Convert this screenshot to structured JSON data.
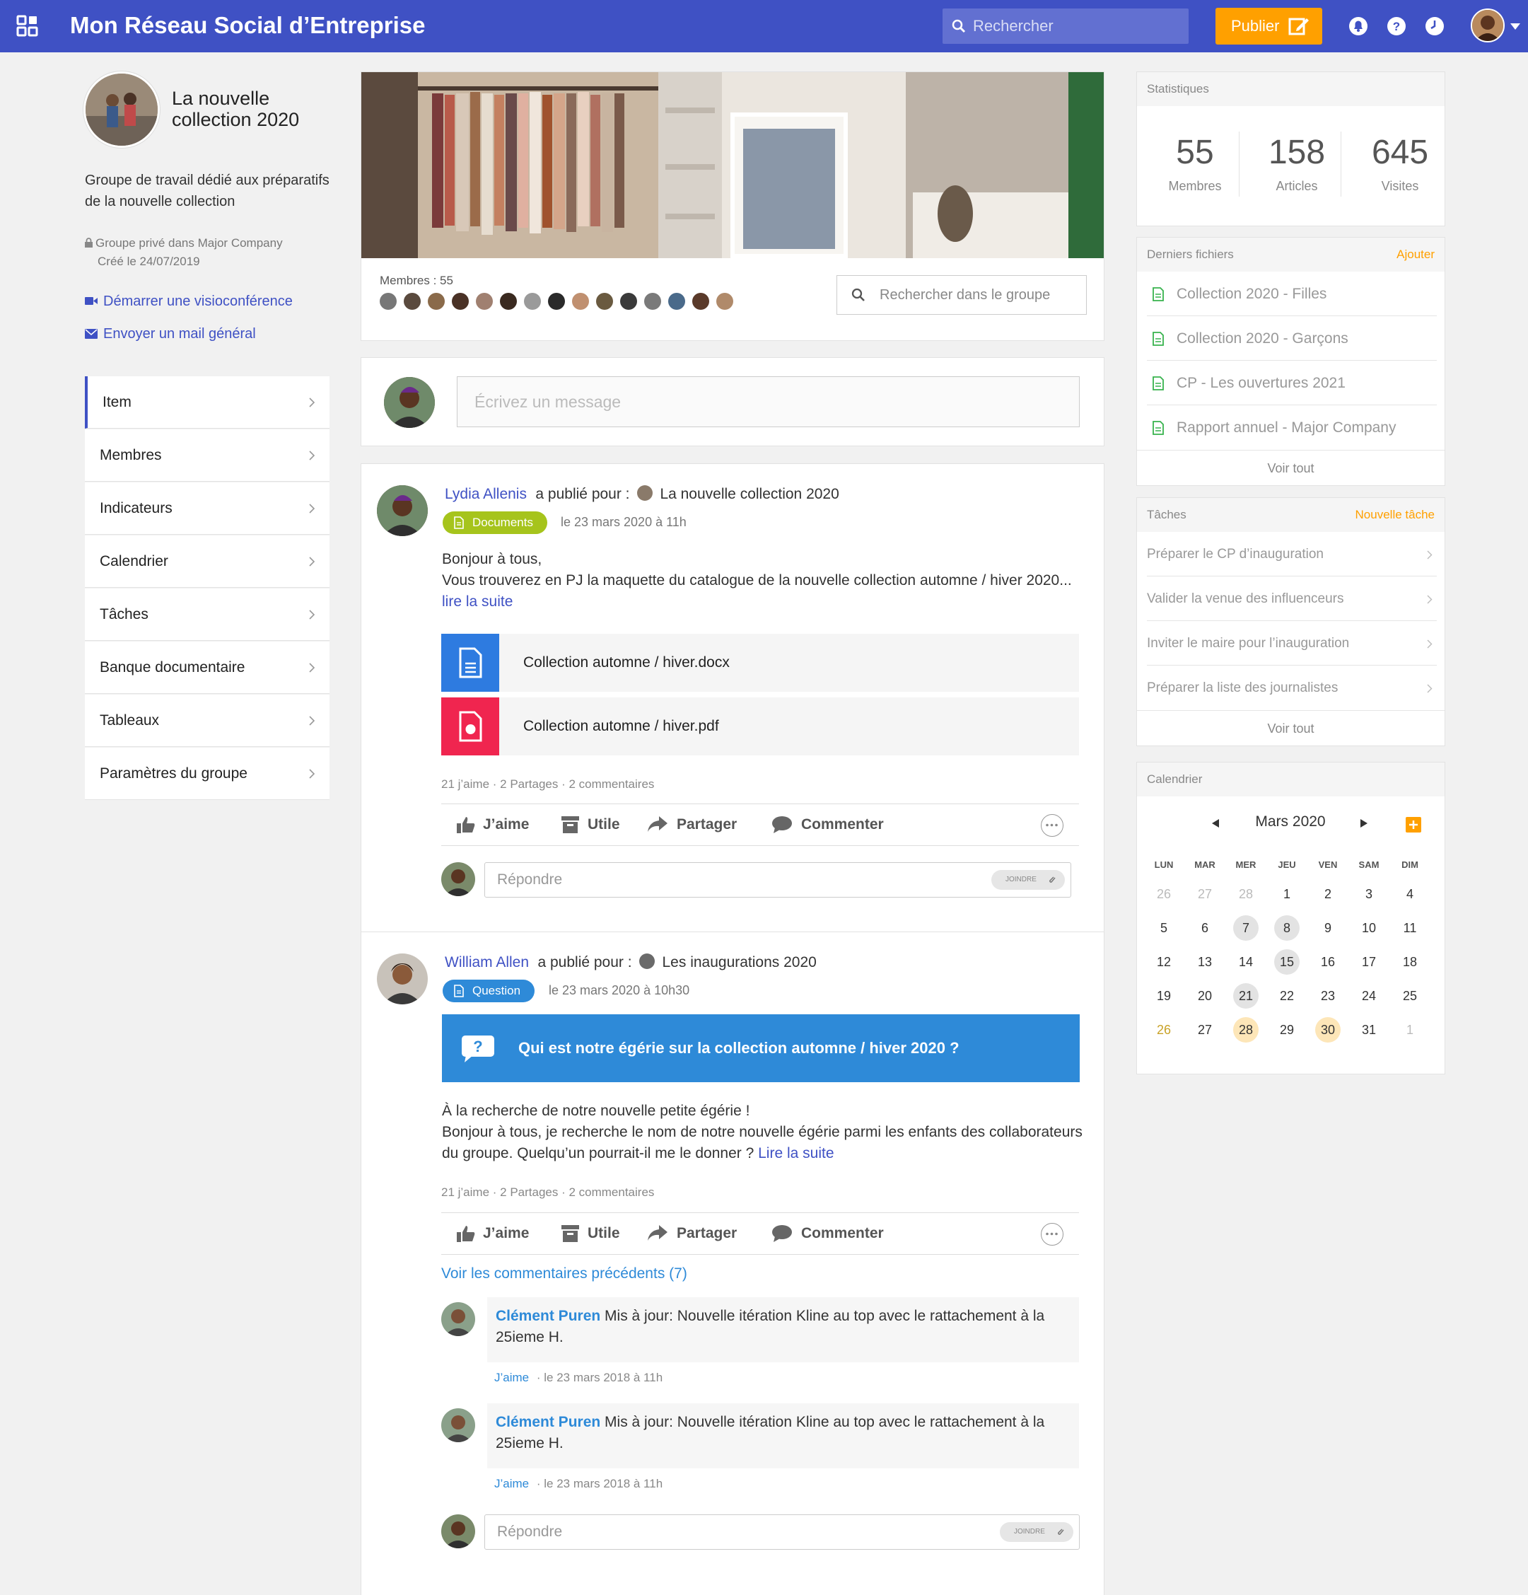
{
  "app": {
    "title": "Mon Réseau Social d’Entreprise",
    "search_placeholder": "Rechercher",
    "publish_label": "Publier"
  },
  "colors": {
    "primary": "#3f51c4",
    "accent": "#ffa000",
    "link": "#2e8ad8"
  },
  "group": {
    "title": "La nouvelle collection 2020",
    "description": "Groupe de travail dédié aux préparatifs de la nouvelle collection",
    "privacy": "Groupe privé dans Major Company",
    "created": "Créé le 24/07/2019",
    "video_link": "Démarrer une visioconférence",
    "mail_link": "Envoyer un mail général"
  },
  "nav": [
    "Item",
    "Membres",
    "Indicateurs",
    "Calendrier",
    "Tâches",
    "Banque documentaire",
    "Tableaux",
    "Paramètres du groupe"
  ],
  "cover": {
    "members_label": "Membres : 55",
    "search_placeholder": "Rechercher dans le groupe"
  },
  "composer": {
    "placeholder": "Écrivez un message"
  },
  "posts": [
    {
      "author": "Lydia Allenis",
      "published_for": "a publié pour :",
      "target": "La nouvelle collection 2020",
      "badge": "Documents",
      "date": "le 23 mars 2020 à 11h",
      "line1": "Bonjour à tous,",
      "line2": "Vous trouverez en PJ la maquette du catalogue de la nouvelle collection automne / hiver 2020...",
      "read_more": "lire la suite",
      "files": [
        "Collection automne / hiver.docx",
        "Collection automne / hiver.pdf"
      ],
      "stats": "21 j’aime · 2 Partages · 2 commentaires",
      "reply_placeholder": "Répondre",
      "joindre": "JOINDRE"
    },
    {
      "author": "William Allen",
      "published_for": "a publié pour :",
      "target": "Les inaugurations 2020",
      "badge": "Question",
      "date": "le 23 mars 2020 à 10h30",
      "question": "Qui est notre égérie sur la collection automne / hiver 2020 ?",
      "line1": "À la recherche de notre nouvelle petite égérie !",
      "line2": "Bonjour à tous, je recherche le nom de notre nouvelle égérie parmi les enfants des collaborateurs",
      "line3": "du groupe. Quelqu’un pourrait-il me le donner ?",
      "read_more": "Lire la suite",
      "stats": "21 j’aime · 2 Partages · 2 commentaires",
      "see_previous": "Voir les commentaires précédents (7)",
      "comments": [
        {
          "author": "Clément Puren",
          "text": "Mis à jour: Nouvelle itération Kline au top avec le rattachement à la",
          "text2": "25ieme H.",
          "like": "J’aime",
          "date": "· le 23 mars 2018 à 11h"
        },
        {
          "author": "Clément Puren",
          "text": "Mis à jour: Nouvelle itération Kline au top avec le rattachement à la",
          "text2": "25ieme H.",
          "like": "J’aime",
          "date": "· le 23 mars 2018 à 11h"
        }
      ],
      "reply_placeholder": "Répondre",
      "joindre": "JOINDRE"
    }
  ],
  "actions": {
    "like": "J’aime",
    "useful": "Utile",
    "share": "Partager",
    "comment": "Commenter"
  },
  "stats_card": {
    "title": "Statistiques",
    "items": [
      {
        "value": "55",
        "label": "Membres"
      },
      {
        "value": "158",
        "label": "Articles"
      },
      {
        "value": "645",
        "label": "Visites"
      }
    ]
  },
  "files_card": {
    "title": "Derniers fichiers",
    "action": "Ajouter",
    "items": [
      "Collection 2020 - Filles",
      "Collection 2020 - Garçons",
      "CP - Les ouvertures 2021",
      "Rapport annuel - Major Company"
    ],
    "see_all": "Voir tout"
  },
  "tasks_card": {
    "title": "Tâches",
    "action": "Nouvelle tâche",
    "items": [
      "Préparer le CP d’inauguration",
      "Valider la venue des influenceurs",
      "Inviter le maire pour l’inauguration",
      "Préparer la liste des journalistes"
    ],
    "see_all": "Voir tout"
  },
  "calendar": {
    "title": "Calendrier",
    "month": "Mars 2020",
    "weekdays": [
      "LUN",
      "MAR",
      "MER",
      "JEU",
      "VEN",
      "SAM",
      "DIM"
    ],
    "weeks": [
      [
        "26",
        "27",
        "28",
        "1",
        "2",
        "3",
        "4"
      ],
      [
        "5",
        "6",
        "7",
        "8",
        "9",
        "10",
        "11"
      ],
      [
        "12",
        "13",
        "14",
        "15",
        "16",
        "17",
        "18"
      ],
      [
        "19",
        "20",
        "21",
        "22",
        "23",
        "24",
        "25"
      ],
      [
        "26",
        "27",
        "28",
        "29",
        "30",
        "31",
        "1"
      ]
    ],
    "highlight_grey": [
      "7",
      "8",
      "15",
      "21"
    ],
    "highlight_orange": [
      "28",
      "30"
    ],
    "today": "26"
  }
}
